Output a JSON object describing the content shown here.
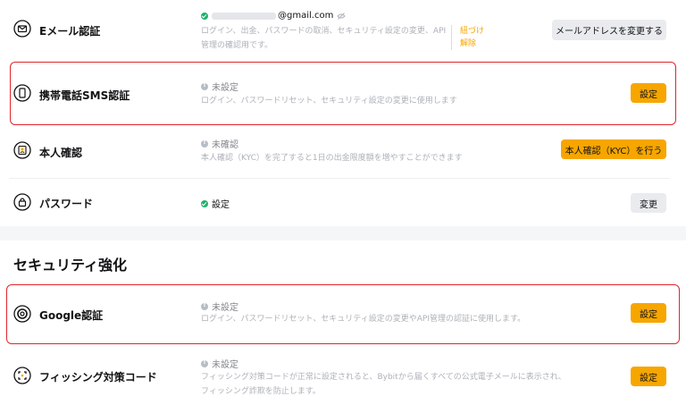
{
  "email": {
    "label": "Eメール認証",
    "address_suffix": "@gmail.com",
    "description": "ログイン、出金、パスワードの取消、セキュリティ設定の変更、API管理の確認用です。",
    "unlink_label": "紐づけ解除",
    "button": "メールアドレスを変更する"
  },
  "sms": {
    "label": "携帯電話SMS認証",
    "status": "未設定",
    "description": "ログイン、パスワードリセット、セキュリティ設定の変更に使用します",
    "button": "設定"
  },
  "kyc": {
    "label": "本人確認",
    "status": "未確認",
    "description": "本人確認（KYC）を完了すると1日の出金限度額を増やすことができます",
    "button": "本人確認（KYC）を行う"
  },
  "password": {
    "label": "パスワード",
    "status": "設定",
    "button": "変更"
  },
  "section": {
    "title": "セキュリティ強化"
  },
  "google": {
    "label": "Google認証",
    "status": "未設定",
    "description": "ログイン、パスワードリセット、セキュリティ設定の変更やAPI管理の認証に使用します。",
    "button": "設定"
  },
  "phishing": {
    "label": "フィッシング対策コード",
    "status": "未設定",
    "description": "フィッシング対策コードが正常に設定されると、Bybitから届くすべての公式電子メールに表示され、フィッシング詐欺を防止します。",
    "button": "設定"
  }
}
